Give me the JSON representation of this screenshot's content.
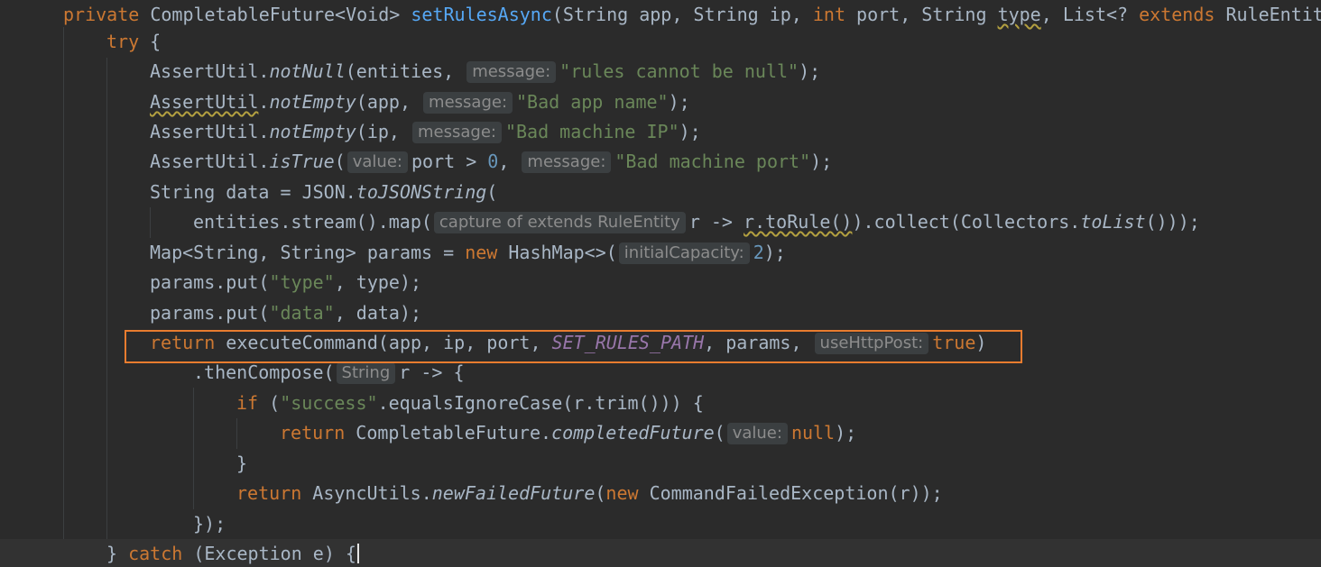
{
  "colors": {
    "background": "#2b2b2b",
    "keyword": "#cc7832",
    "method": "#56a8f5",
    "string": "#6a8759",
    "number": "#6897bb",
    "constant": "#9876aa",
    "highlight": "#e87c2f"
  },
  "l1": {
    "a": "private",
    "b": " CompletableFuture<Void> ",
    "c": "setRulesAsync",
    "d": "(String app, String ip, ",
    "e": "int",
    "f": " port, String ",
    "g": "type",
    "h": ", List<? ",
    "i": "extends",
    "j": " RuleEntity"
  },
  "l2": {
    "a": "try",
    "b": " {"
  },
  "l3": {
    "a": "AssertUtil.",
    "b": "notNull",
    "c": "(entities, ",
    "h": "message:",
    "s": "\"rules cannot be null\"",
    "e": ");"
  },
  "l4": {
    "a": "AssertUtil",
    "a2": ".",
    "b": "notEmpty",
    "c": "(app, ",
    "h": "message:",
    "s": "\"Bad app name\"",
    "e": ");"
  },
  "l5": {
    "a": "AssertUtil.",
    "b": "notEmpty",
    "c": "(ip, ",
    "h": "message:",
    "s": "\"Bad machine IP\"",
    "e": ");"
  },
  "l6": {
    "a": "AssertUtil.",
    "b": "isTrue",
    "c": "(",
    "h1": "value:",
    "d": "port > ",
    "n": "0",
    "e": ", ",
    "h2": "message:",
    "s": "\"Bad machine port\"",
    "f": ");"
  },
  "l7": {
    "a": "String data = JSON.",
    "b": "toJSONString",
    "c": "("
  },
  "l8": {
    "a": "entities.stream().map(",
    "h": "capture of extends RuleEntity",
    "b": "r -> ",
    "c": "r.toRule()",
    "d": ").collect(Collectors.",
    "e": "toList",
    "f": "()));"
  },
  "l9": {
    "a": "Map<String, String> params = ",
    "k": "new",
    "b": " HashMap<>(",
    "h": "initialCapacity:",
    "n": "2",
    "e": ");"
  },
  "l10": {
    "a": "params.put(",
    "s": "\"type\"",
    "b": ", type);"
  },
  "l11": {
    "a": "params.put(",
    "s": "\"data\"",
    "b": ", data);"
  },
  "l12": {
    "k": "return",
    "a": " executeCommand(app, ip, port, ",
    "c": "SET_RULES_PATH",
    "b": ", params, ",
    "h": "useHttpPost:",
    "v": "true",
    "e": ")"
  },
  "l13": {
    "a": ".thenCompose(",
    "h": "String",
    "b": "r -> {"
  },
  "l14": {
    "k": "if",
    "a": " (",
    "s": "\"success\"",
    "b": ".equalsIgnoreCase(r.trim())) {"
  },
  "l15": {
    "k": "return",
    "a": " CompletableFuture.",
    "b": "completedFuture",
    "c": "(",
    "h": "value:",
    "v": "null",
    "e": ");"
  },
  "l16": {
    "a": "}"
  },
  "l17": {
    "k": "return",
    "a": " AsyncUtils.",
    "b": "newFailedFuture",
    "c": "(",
    "k2": "new",
    "d": " CommandFailedException(r));"
  },
  "l18": {
    "a": "});"
  },
  "l19": {
    "a": "} ",
    "k": "catch",
    "b": " (Exception e) {"
  }
}
